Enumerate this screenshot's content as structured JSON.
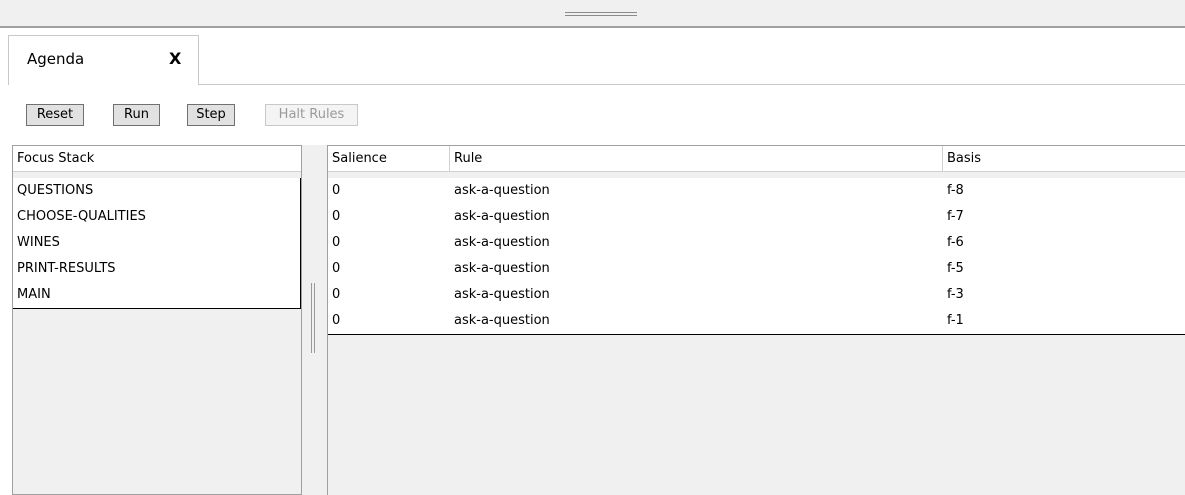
{
  "tab": {
    "label": "Agenda",
    "close": "X"
  },
  "toolbar": {
    "reset": "Reset",
    "run": "Run",
    "step": "Step",
    "halt": "Halt Rules"
  },
  "focus_stack": {
    "header": "Focus Stack",
    "items": [
      "QUESTIONS",
      "CHOOSE-QUALITIES",
      "WINES",
      "PRINT-RESULTS",
      "MAIN"
    ]
  },
  "agenda_table": {
    "headers": {
      "salience": "Salience",
      "rule": "Rule",
      "basis": "Basis"
    },
    "rows": [
      {
        "salience": "0",
        "rule": "ask-a-question",
        "basis": "f-8"
      },
      {
        "salience": "0",
        "rule": "ask-a-question",
        "basis": "f-7"
      },
      {
        "salience": "0",
        "rule": "ask-a-question",
        "basis": "f-6"
      },
      {
        "salience": "0",
        "rule": "ask-a-question",
        "basis": "f-5"
      },
      {
        "salience": "0",
        "rule": "ask-a-question",
        "basis": "f-3"
      },
      {
        "salience": "0",
        "rule": "ask-a-question",
        "basis": "f-1"
      }
    ]
  }
}
